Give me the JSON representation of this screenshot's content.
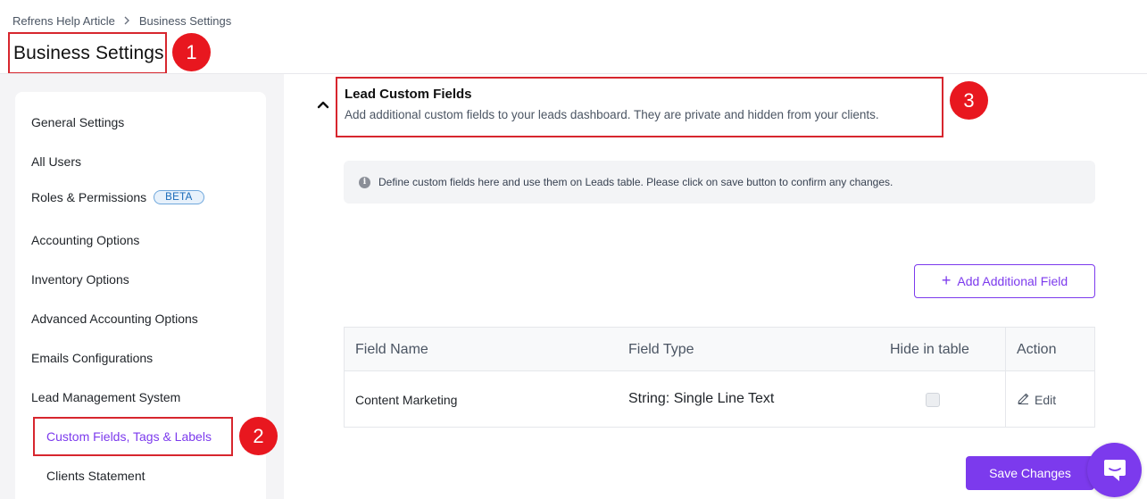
{
  "breadcrumb": {
    "items": [
      "Refrens Help Article",
      "Business Settings"
    ],
    "separator": ">"
  },
  "page_title": "Business Settings",
  "annotations": {
    "badge_1": "1",
    "badge_2": "2",
    "badge_3": "3",
    "badge_color": "#e8171f",
    "highlight_color": "#d7262e"
  },
  "sidebar": {
    "items": [
      {
        "label": "General Settings"
      },
      {
        "label": "All Users"
      },
      {
        "label": "Roles & Permissions",
        "badge": "BETA"
      },
      {
        "label": "Accounting Options"
      },
      {
        "label": "Inventory Options"
      },
      {
        "label": "Advanced Accounting Options"
      },
      {
        "label": "Emails Configurations"
      },
      {
        "label": "Lead Management System"
      },
      {
        "label": "Custom Fields, Tags & Labels",
        "active": true
      },
      {
        "label": "Clients Statement"
      }
    ]
  },
  "section": {
    "title": "Lead Custom Fields",
    "subtitle": "Add additional custom fields to your leads dashboard. They are private and hidden from your clients.",
    "collapse_icon": "chevron-up-icon",
    "info_text": "Define custom fields here and use them on Leads table. Please click on save button to confirm any changes.",
    "add_button": "Add Additional Field"
  },
  "table": {
    "headers": [
      "Field Name",
      "Field Type",
      "Hide in table",
      "Action"
    ],
    "rows": [
      {
        "field_name": "Content Marketing",
        "field_type": "String: Single Line Text",
        "hide_in_table": false,
        "action": "Edit"
      }
    ]
  },
  "footer": {
    "save_button": "Save Changes",
    "chat_icon": "chat-bubble-icon"
  },
  "colors": {
    "accent": "#7c3aed",
    "beta_text": "#1668b8"
  }
}
